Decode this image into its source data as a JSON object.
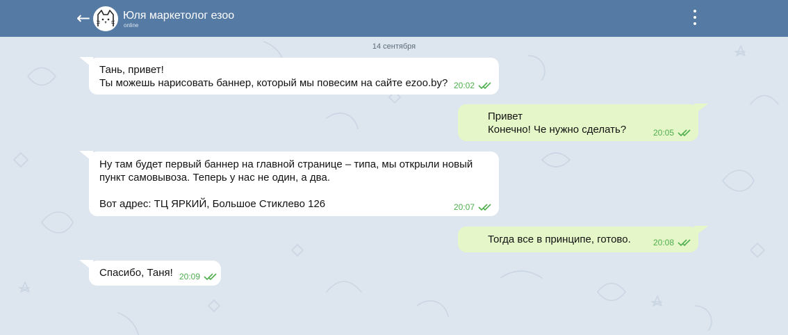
{
  "colors": {
    "header": "#557aa3",
    "background": "#dde6ef",
    "incoming_bubble": "#ffffff",
    "outgoing_bubble": "#e5f7c8",
    "time_and_ticks": "#4fae4e"
  },
  "header": {
    "back_icon": "back-arrow-icon",
    "avatar_icon": "cat-avatar",
    "contact_name": "Юля маркетолог езоо",
    "status": "online",
    "menu_icon": "more-vertical-icon"
  },
  "chat": {
    "date_label": "14 сентября",
    "messages": [
      {
        "direction": "incoming",
        "text": "Тань, привет!\nТы можешь нарисовать баннер, который мы повесим на сайте ezoo.by?",
        "time": "20:02",
        "read_icon": "double-check-icon"
      },
      {
        "direction": "outgoing",
        "text": "Привет\nКонечно! Че нужно сделать?",
        "time": "20:05",
        "read_icon": "double-check-icon"
      },
      {
        "direction": "incoming",
        "text": "Ну там будет первый баннер на главной странице – типа, мы открыли новый\nпункт самовывоза. Теперь у нас не один, а два.\n\nВот адрес: ТЦ ЯРКИЙ, Большое Стиклево 126",
        "time": "20:07",
        "read_icon": "double-check-icon"
      },
      {
        "direction": "outgoing",
        "text": "Тогда все в принципе, готово.",
        "time": "20:08",
        "read_icon": "double-check-icon"
      },
      {
        "direction": "incoming",
        "text": "Спасибо, Таня!",
        "time": "20:09",
        "read_icon": "double-check-icon"
      }
    ]
  }
}
